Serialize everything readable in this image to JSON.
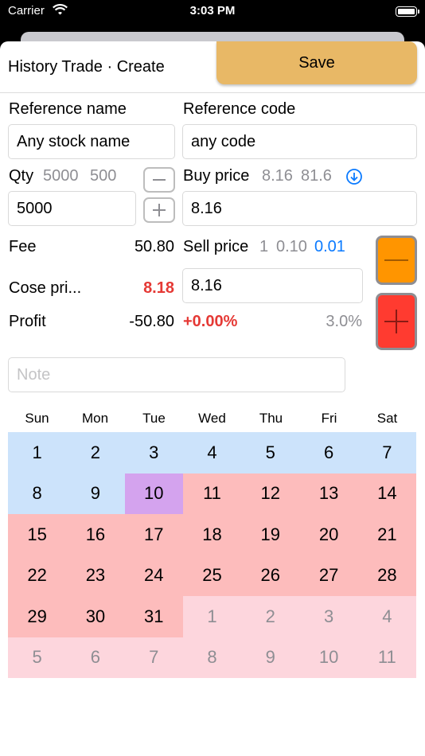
{
  "status_bar": {
    "carrier": "Carrier",
    "time": "3:03 PM"
  },
  "header": {
    "title": "History Trade ·  Create",
    "save_label": "Save"
  },
  "reference": {
    "name_label": "Reference name",
    "name_value": "Any stock name",
    "code_label": "Reference code",
    "code_value": "any code"
  },
  "qty": {
    "label": "Qty",
    "preset_1": "5000",
    "preset_2": "500",
    "value": "5000"
  },
  "buy_price": {
    "label": "Buy price",
    "preset_1": "8.16",
    "preset_2": "81.6",
    "value": "8.16"
  },
  "sell_price": {
    "label": "Sell price",
    "step_1": "1",
    "step_2": "0.10",
    "step_3": "0.01",
    "value": "8.16"
  },
  "fee": {
    "label": "Fee",
    "value": "50.80"
  },
  "close_price": {
    "label": "Cose pri...",
    "value": "8.18"
  },
  "profit": {
    "label": "Profit",
    "value": "-50.80",
    "percent": "+0.00%",
    "rate": "3.0%"
  },
  "note": {
    "placeholder": "Note"
  },
  "colors": {
    "save": "#e8b866",
    "minus": "#ff9500",
    "plus": "#ff3b30",
    "blue_day": "#cce3fb",
    "red_day": "#fdbcbc",
    "pink_day": "#fdd6dd",
    "today": "#d4a3ee"
  },
  "calendar": {
    "weekdays": [
      "Sun",
      "Mon",
      "Tue",
      "Wed",
      "Thu",
      "Fri",
      "Sat"
    ],
    "days": [
      [
        "1",
        "2",
        "3",
        "4",
        "5",
        "6",
        "7"
      ],
      [
        "8",
        "9",
        "10",
        "11",
        "12",
        "13",
        "14"
      ],
      [
        "15",
        "16",
        "17",
        "18",
        "19",
        "20",
        "21"
      ],
      [
        "22",
        "23",
        "24",
        "25",
        "26",
        "27",
        "28"
      ],
      [
        "29",
        "30",
        "31",
        "1",
        "2",
        "3",
        "4"
      ],
      [
        "5",
        "6",
        "7",
        "8",
        "9",
        "10",
        "11"
      ]
    ]
  }
}
